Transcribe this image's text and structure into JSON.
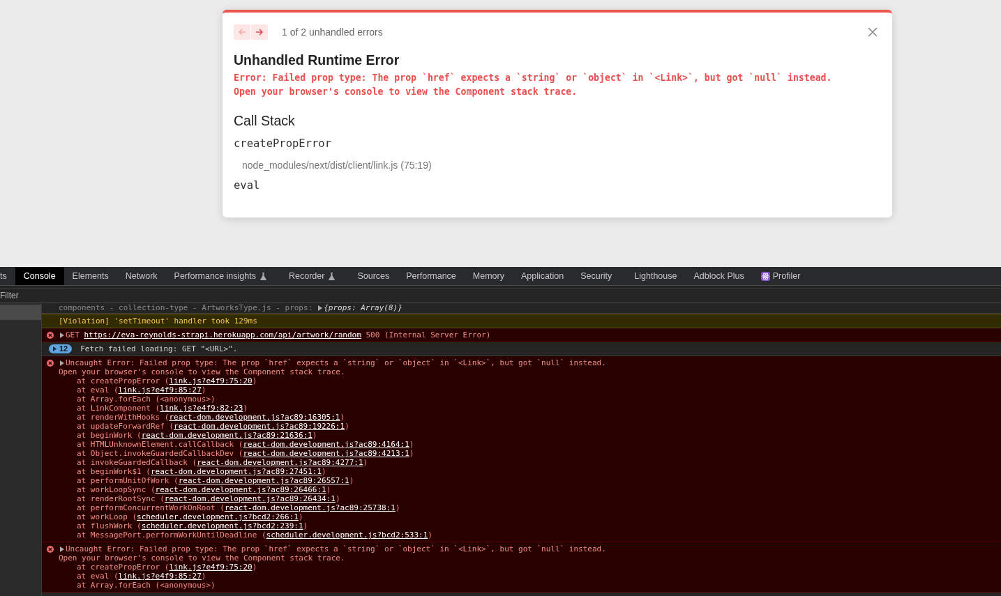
{
  "overlay": {
    "nav": [
      {
        "kind": "prev",
        "disabled": true
      },
      {
        "kind": "next",
        "disabled": false
      }
    ],
    "counter": "1 of 2 unhandled errors",
    "title": "Unhandled Runtime Error",
    "message": [
      "Error: Failed prop type: The prop `href` expects a `string` or `object` in `<Link>`, but got `null` instead.",
      "Open your browser's console to view the Component stack trace."
    ],
    "call_stack_title": "Call Stack",
    "frames": [
      {
        "name": "createPropError",
        "location": "node_modules/next/dist/client/link.js (75:19)"
      },
      {
        "name": "eval"
      }
    ]
  },
  "devtools": {
    "tabs": [
      {
        "label": "ts",
        "selected": false,
        "kind": "plain"
      },
      {
        "label": "Console",
        "selected": true,
        "kind": "plain"
      },
      {
        "label": "Elements",
        "selected": false,
        "kind": "plain"
      },
      {
        "label": "Network",
        "selected": false,
        "kind": "plain"
      },
      {
        "label": "Performance insights",
        "selected": false,
        "kind": "experiment"
      },
      {
        "label": "Recorder",
        "selected": false,
        "kind": "experiment"
      },
      {
        "label": "Sources",
        "selected": false,
        "kind": "plain"
      },
      {
        "label": "Performance",
        "selected": false,
        "kind": "plain"
      },
      {
        "label": "Memory",
        "selected": false,
        "kind": "plain"
      },
      {
        "label": "Application",
        "selected": false,
        "kind": "plain"
      },
      {
        "label": "Security",
        "selected": false,
        "kind": "plain"
      },
      {
        "label": "Lighthouse",
        "selected": false,
        "kind": "plain"
      },
      {
        "label": "Adblock Plus",
        "selected": false,
        "kind": "plain"
      },
      {
        "label": "Profiler",
        "selected": false,
        "kind": "extension"
      }
    ],
    "filter": {
      "placeholder": "Filter"
    },
    "entries": [
      {
        "kind": "log",
        "message": [
          {
            "before": "components - collection-type - ArtworksType.js - props:"
          }
        ],
        "value": "{props: Array(8)}"
      },
      {
        "kind": "warning",
        "message": [
          {
            "before": "[Violation] 'setTimeout' handler took 129ms"
          }
        ]
      },
      {
        "kind": "error",
        "expandable": true,
        "message": [
          {
            "before": "GET ",
            "link": "https://eva-reynolds-strapi.herokuapp.com/api/artwork/random",
            "after": " 500 (Internal Server Error)"
          }
        ]
      },
      {
        "kind": "group",
        "count": "12",
        "message": [
          {
            "before": "Fetch failed loading: GET \"<URL>\"."
          }
        ]
      },
      {
        "kind": "error",
        "expandable": true,
        "message": [
          {
            "before": "Uncaught Error: Failed prop type: The prop `href` expects a `string` or `object` in `<Link>`, but got `null` instead."
          },
          {
            "before": "Open your browser's console to view the Component stack trace."
          }
        ],
        "stack": [
          {
            "before": "at createPropError (",
            "link": "link.js?e4f9:75:20",
            "after": ")"
          },
          {
            "before": "at eval (",
            "link": "link.js?e4f9:85:27",
            "after": ")"
          },
          {
            "before": "at Array.forEach (<anonymous>)"
          },
          {
            "before": "at LinkComponent (",
            "link": "link.js?e4f9:82:23",
            "after": ")"
          },
          {
            "before": "at renderWithHooks (",
            "link": "react-dom.development.js?ac89:16305:1",
            "after": ")"
          },
          {
            "before": "at updateForwardRef (",
            "link": "react-dom.development.js?ac89:19226:1",
            "after": ")"
          },
          {
            "before": "at beginWork (",
            "link": "react-dom.development.js?ac89:21636:1",
            "after": ")"
          },
          {
            "before": "at HTMLUnknownElement.callCallback (",
            "link": "react-dom.development.js?ac89:4164:1",
            "after": ")"
          },
          {
            "before": "at Object.invokeGuardedCallbackDev (",
            "link": "react-dom.development.js?ac89:4213:1",
            "after": ")"
          },
          {
            "before": "at invokeGuardedCallback (",
            "link": "react-dom.development.js?ac89:4277:1",
            "after": ")"
          },
          {
            "before": "at beginWork$1 (",
            "link": "react-dom.development.js?ac89:27451:1",
            "after": ")"
          },
          {
            "before": "at performUnitOfWork (",
            "link": "react-dom.development.js?ac89:26557:1",
            "after": ")"
          },
          {
            "before": "at workLoopSync (",
            "link": "react-dom.development.js?ac89:26466:1",
            "after": ")"
          },
          {
            "before": "at renderRootSync (",
            "link": "react-dom.development.js?ac89:26434:1",
            "after": ")"
          },
          {
            "before": "at performConcurrentWorkOnRoot (",
            "link": "react-dom.development.js?ac89:25738:1",
            "after": ")"
          },
          {
            "before": "at workLoop (",
            "link": "scheduler.development.js?bcd2:266:1",
            "after": ")"
          },
          {
            "before": "at flushWork (",
            "link": "scheduler.development.js?bcd2:239:1",
            "after": ")"
          },
          {
            "before": "at MessagePort.performWorkUntilDeadline (",
            "link": "scheduler.development.js?bcd2:533:1",
            "after": ")"
          }
        ]
      },
      {
        "kind": "error",
        "expandable": true,
        "message": [
          {
            "before": "Uncaught Error: Failed prop type: The prop `href` expects a `string` or `object` in `<Link>`, but got `null` instead."
          },
          {
            "before": "Open your browser's console to view the Component stack trace."
          }
        ],
        "stack": [
          {
            "before": "at createPropError (",
            "link": "link.js?e4f9:75:20",
            "after": ")"
          },
          {
            "before": "at eval (",
            "link": "link.js?e4f9:85:27",
            "after": ")"
          },
          {
            "before": "at Array.forEach (<anonymous>)"
          }
        ]
      }
    ]
  }
}
